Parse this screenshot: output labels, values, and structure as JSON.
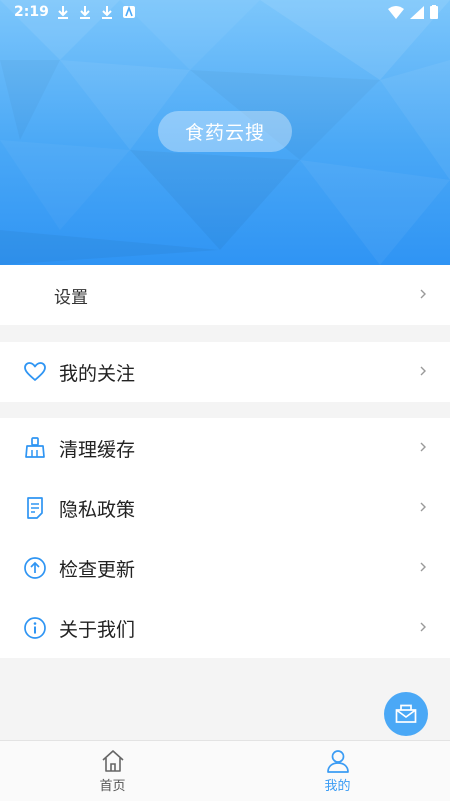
{
  "status_bar": {
    "time": "2:19"
  },
  "header": {
    "app_name": "食药云搜"
  },
  "settings": {
    "label": "设置"
  },
  "menu_group_1": [
    {
      "label": "我的关注",
      "icon": "heart-icon"
    }
  ],
  "menu_group_2": [
    {
      "label": "清理缓存",
      "icon": "broom-icon"
    },
    {
      "label": "隐私政策",
      "icon": "document-icon"
    },
    {
      "label": "检查更新",
      "icon": "arrow-up-circle-icon"
    },
    {
      "label": "关于我们",
      "icon": "info-circle-icon"
    }
  ],
  "bottom_nav": {
    "items": [
      {
        "label": "首页",
        "icon": "home-icon",
        "active": false
      },
      {
        "label": "我的",
        "icon": "user-icon",
        "active": true
      }
    ]
  },
  "colors": {
    "accent": "#3b9cf4",
    "icon_blue": "#2f95f3",
    "chevron": "#9a9a9a"
  }
}
